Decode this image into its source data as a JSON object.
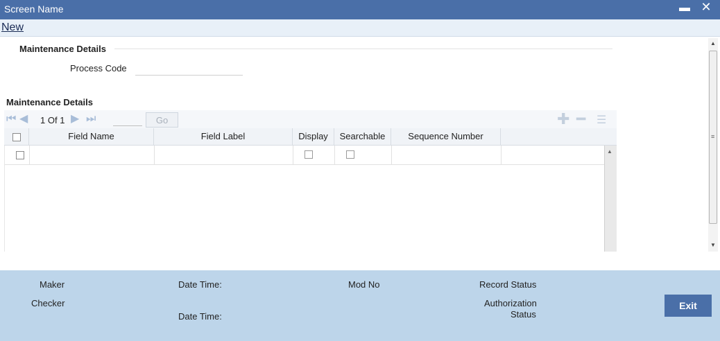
{
  "window": {
    "title": "Screen Name",
    "minimize_glyph": "▬",
    "close_glyph": "✕"
  },
  "menu": {
    "new_label": "New"
  },
  "maintenance_section": {
    "title": "Maintenance Details",
    "process_code_label": "Process Code",
    "process_code_value": ""
  },
  "grid_section": {
    "title": "Maintenance Details",
    "pagination": {
      "current": "1",
      "of_label": "Of",
      "total": "1",
      "page_input": "",
      "go_label": "Go"
    },
    "columns": [
      "Field Name",
      "Field Label",
      "Display",
      "Searchable",
      "Sequence Number"
    ],
    "rows": [
      {
        "field_name": "",
        "field_label": "",
        "display": false,
        "searchable": false,
        "sequence_number": ""
      }
    ]
  },
  "footer": {
    "maker_label": "Maker",
    "checker_label": "Checker",
    "date_time_label": "Date Time:",
    "mod_no_label": "Mod No",
    "record_status_label": "Record Status",
    "authorization_label": "Authorization",
    "status_label": "Status",
    "exit_label": "Exit"
  },
  "colors": {
    "titlebar": "#4a6fa8",
    "footer": "#bdd5ea",
    "nav_icons": "#a8bdd8"
  }
}
